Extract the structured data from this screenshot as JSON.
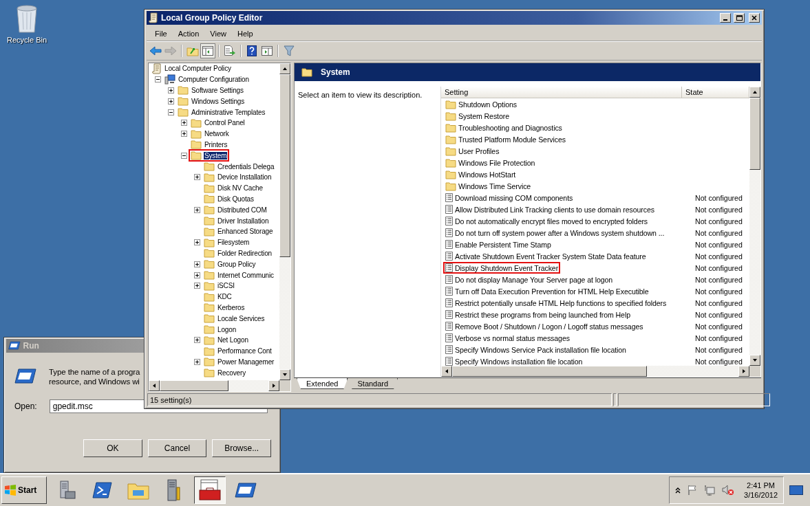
{
  "desktop": {
    "icons": [
      {
        "label": "Recycle Bin"
      }
    ]
  },
  "run_dialog": {
    "title": "Run",
    "prompt_lines": [
      "Type the name of a progra",
      "resource, and Windows wi"
    ],
    "open_label": "Open:",
    "open_value": "gpedit.msc",
    "buttons": [
      "OK",
      "Cancel",
      "Browse..."
    ]
  },
  "window": {
    "title": "Local Group Policy Editor",
    "menu": [
      "File",
      "Action",
      "View",
      "Help"
    ],
    "toolbar": [
      {
        "kind": "back",
        "pressed": false,
        "disabled": false
      },
      {
        "kind": "forward",
        "pressed": false,
        "disabled": true
      },
      {
        "kind": "up",
        "pressed": false,
        "disabled": false
      },
      {
        "kind": "tree",
        "pressed": true,
        "disabled": false
      },
      {
        "kind": "export",
        "pressed": false,
        "disabled": false
      },
      {
        "kind": "help",
        "pressed": false,
        "disabled": false
      },
      {
        "kind": "action-pane",
        "pressed": false,
        "disabled": false
      },
      {
        "kind": "filter",
        "pressed": false,
        "disabled": false
      }
    ],
    "tree": [
      {
        "label": "Local Computer Policy",
        "kind": "policy",
        "selected": false,
        "marked": false,
        "children": [
          {
            "label": "Computer Configuration",
            "kind": "computer",
            "expanded": true,
            "selected": false,
            "marked": false,
            "children": [
              {
                "label": "Software Settings",
                "kind": "folder",
                "expanded": false,
                "selected": false,
                "marked": false
              },
              {
                "label": "Windows Settings",
                "kind": "folder",
                "expanded": false,
                "selected": false,
                "marked": false
              },
              {
                "label": "Administrative Templates",
                "kind": "folder",
                "expanded": true,
                "selected": false,
                "marked": false,
                "children": [
                  {
                    "label": "Control Panel",
                    "kind": "folder",
                    "expanded": false,
                    "selected": false,
                    "marked": false
                  },
                  {
                    "label": "Network",
                    "kind": "folder",
                    "expanded": false,
                    "selected": false,
                    "marked": false
                  },
                  {
                    "label": "Printers",
                    "kind": "folder",
                    "selected": false,
                    "marked": false
                  },
                  {
                    "label": "System",
                    "kind": "folder",
                    "expanded": true,
                    "selected": true,
                    "marked": true,
                    "children": [
                      {
                        "label": "Credentials Delega",
                        "kind": "folder",
                        "selected": false,
                        "marked": false
                      },
                      {
                        "label": "Device Installation",
                        "kind": "folder",
                        "expanded": false,
                        "selected": false,
                        "marked": false
                      },
                      {
                        "label": "Disk NV Cache",
                        "kind": "folder",
                        "selected": false,
                        "marked": false
                      },
                      {
                        "label": "Disk Quotas",
                        "kind": "folder",
                        "selected": false,
                        "marked": false
                      },
                      {
                        "label": "Distributed COM",
                        "kind": "folder",
                        "expanded": false,
                        "selected": false,
                        "marked": false
                      },
                      {
                        "label": "Driver Installation",
                        "kind": "folder",
                        "selected": false,
                        "marked": false
                      },
                      {
                        "label": "Enhanced Storage",
                        "kind": "folder",
                        "selected": false,
                        "marked": false
                      },
                      {
                        "label": "Filesystem",
                        "kind": "folder",
                        "expanded": false,
                        "selected": false,
                        "marked": false
                      },
                      {
                        "label": "Folder Redirection",
                        "kind": "folder",
                        "selected": false,
                        "marked": false
                      },
                      {
                        "label": "Group Policy",
                        "kind": "folder",
                        "expanded": false,
                        "selected": false,
                        "marked": false
                      },
                      {
                        "label": "Internet Communic",
                        "kind": "folder",
                        "expanded": false,
                        "selected": false,
                        "marked": false
                      },
                      {
                        "label": "iSCSI",
                        "kind": "folder",
                        "expanded": false,
                        "selected": false,
                        "marked": false
                      },
                      {
                        "label": "KDC",
                        "kind": "folder",
                        "selected": false,
                        "marked": false
                      },
                      {
                        "label": "Kerberos",
                        "kind": "folder",
                        "selected": false,
                        "marked": false
                      },
                      {
                        "label": "Locale Services",
                        "kind": "folder",
                        "selected": false,
                        "marked": false
                      },
                      {
                        "label": "Logon",
                        "kind": "folder",
                        "selected": false,
                        "marked": false
                      },
                      {
                        "label": "Net Logon",
                        "kind": "folder",
                        "expanded": false,
                        "selected": false,
                        "marked": false
                      },
                      {
                        "label": "Performance Cont",
                        "kind": "folder",
                        "selected": false,
                        "marked": false
                      },
                      {
                        "label": "Power Managemer",
                        "kind": "folder",
                        "expanded": false,
                        "selected": false,
                        "marked": false
                      },
                      {
                        "label": "Recovery",
                        "kind": "folder",
                        "selected": false,
                        "marked": false
                      }
                    ]
                  }
                ]
              }
            ]
          }
        ]
      }
    ],
    "details": {
      "title": "System",
      "description": "Select an item to view its description.",
      "columns": [
        "Setting",
        "State"
      ],
      "rows": [
        {
          "kind": "folder",
          "setting": "Shutdown Options",
          "marked": false
        },
        {
          "kind": "folder",
          "setting": "System Restore",
          "marked": false
        },
        {
          "kind": "folder",
          "setting": "Troubleshooting and Diagnostics",
          "marked": false
        },
        {
          "kind": "folder",
          "setting": "Trusted Platform Module Services",
          "marked": false
        },
        {
          "kind": "folder",
          "setting": "User Profiles",
          "marked": false
        },
        {
          "kind": "folder",
          "setting": "Windows File Protection",
          "marked": false
        },
        {
          "kind": "folder",
          "setting": "Windows HotStart",
          "marked": false
        },
        {
          "kind": "folder",
          "setting": "Windows Time Service",
          "marked": false
        },
        {
          "kind": "policy",
          "setting": "Download missing COM components",
          "state": "Not configured",
          "marked": false
        },
        {
          "kind": "policy",
          "setting": "Allow Distributed Link Tracking clients to use domain resources",
          "state": "Not configured",
          "marked": false
        },
        {
          "kind": "policy",
          "setting": "Do not automatically encrypt files moved to encrypted folders",
          "state": "Not configured",
          "marked": false
        },
        {
          "kind": "policy",
          "setting": "Do not turn off system power after a Windows system shutdown ...",
          "state": "Not configured",
          "marked": false
        },
        {
          "kind": "policy",
          "setting": "Enable Persistent Time Stamp",
          "state": "Not configured",
          "marked": false
        },
        {
          "kind": "policy",
          "setting": "Activate Shutdown Event Tracker System State Data feature",
          "state": "Not configured",
          "marked": false
        },
        {
          "kind": "policy",
          "setting": "Display Shutdown Event Tracker",
          "state": "Not configured",
          "marked": true
        },
        {
          "kind": "policy",
          "setting": "Do not display Manage Your Server page at logon",
          "state": "Not configured",
          "marked": false
        },
        {
          "kind": "policy",
          "setting": "Turn off Data Execution Prevention for HTML Help Executible",
          "state": "Not configured",
          "marked": false
        },
        {
          "kind": "policy",
          "setting": "Restrict potentially unsafe HTML Help functions to specified folders",
          "state": "Not configured",
          "marked": false
        },
        {
          "kind": "policy",
          "setting": "Restrict these programs from being launched from Help",
          "state": "Not configured",
          "marked": false
        },
        {
          "kind": "policy",
          "setting": "Remove Boot / Shutdown / Logon / Logoff status messages",
          "state": "Not configured",
          "marked": false
        },
        {
          "kind": "policy",
          "setting": "Verbose vs normal status messages",
          "state": "Not configured",
          "marked": false
        },
        {
          "kind": "policy",
          "setting": "Specify Windows Service Pack installation file location",
          "state": "Not configured",
          "marked": false
        },
        {
          "kind": "policy",
          "setting": "Specify Windows installation file location",
          "state": "Not configured",
          "marked": false
        }
      ],
      "tabs": [
        {
          "label": "Extended",
          "selected": true
        },
        {
          "label": "Standard",
          "selected": false
        }
      ]
    },
    "status_bar": [
      "15 setting(s)"
    ]
  },
  "taskbar": {
    "start": "Start",
    "apps": [
      {
        "kind": "server-manager",
        "selected": false
      },
      {
        "kind": "powershell",
        "selected": false
      },
      {
        "kind": "explorer",
        "selected": false
      },
      {
        "kind": "admin-tools",
        "selected": false
      },
      {
        "kind": "toolbox",
        "selected": true
      },
      {
        "kind": "run",
        "selected": false
      }
    ],
    "time": "2:41 PM",
    "date": "3/16/2012"
  }
}
